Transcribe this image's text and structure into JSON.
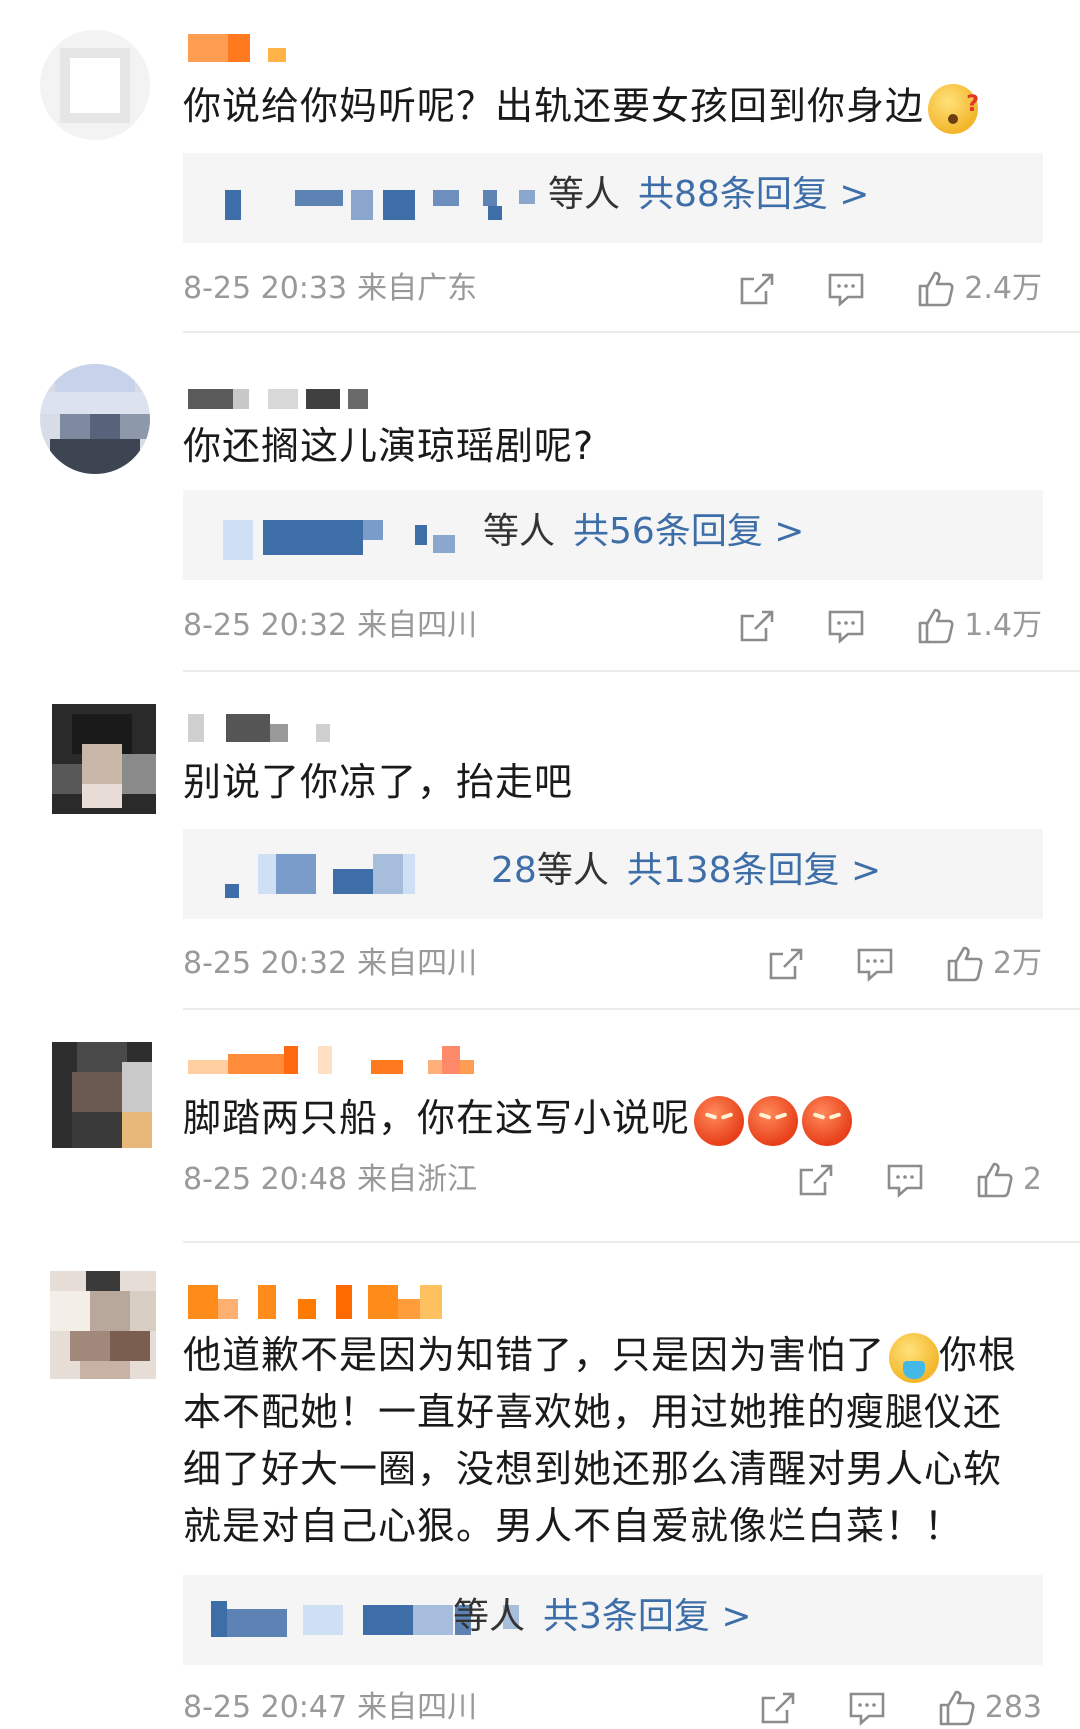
{
  "colors": {
    "link_blue": "#3e6ea8",
    "meta_gray": "#999999",
    "reply_bg": "#f5f5f5",
    "divider": "#ececec",
    "username_orange": "#ff8c1a"
  },
  "comments": [
    {
      "text": "你说给你妈听呢？出轨还要女孩回到你身边",
      "emoji": "confused-face-emoji",
      "reply_who": "等人",
      "reply_count": "共88条回复 >",
      "time": "8-25 20:33",
      "location": "来自广东",
      "likes": "2.4万"
    },
    {
      "text": "你还搁这儿演琼瑶剧呢?",
      "reply_who": "等人",
      "reply_count": "共56条回复 >",
      "time": "8-25 20:32",
      "location": "来自四川",
      "likes": "1.4万"
    },
    {
      "text": "别说了你凉了，抬走吧",
      "reply_prefix": "28",
      "reply_who": "等人",
      "reply_count": "共138条回复 >",
      "time": "8-25 20:32",
      "location": "来自四川",
      "likes": "2万"
    },
    {
      "text": "脚踏两只船，你在这写小说呢",
      "emoji": "angry-face-emoji",
      "time": "8-25 20:48",
      "location": "来自浙江",
      "likes": "2"
    },
    {
      "text_line1": "他道歉不是因为知错了，只是因为害怕了",
      "text_line1_end": "你根",
      "text_line2": "本不配她！一直好喜欢她，用过她推的瘦腿仪还",
      "text_line3": "细了好大一圈，没想到她还那么清醒对男人心软",
      "text_line4": "就是对自己心狠。男人不自爱就像烂白菜！！",
      "emoji": "vomiting-face-emoji",
      "reply_who": "等人",
      "reply_count": "共3条回复 >",
      "time": "8-25 20:47",
      "location": "来自四川",
      "likes": "283"
    }
  ]
}
